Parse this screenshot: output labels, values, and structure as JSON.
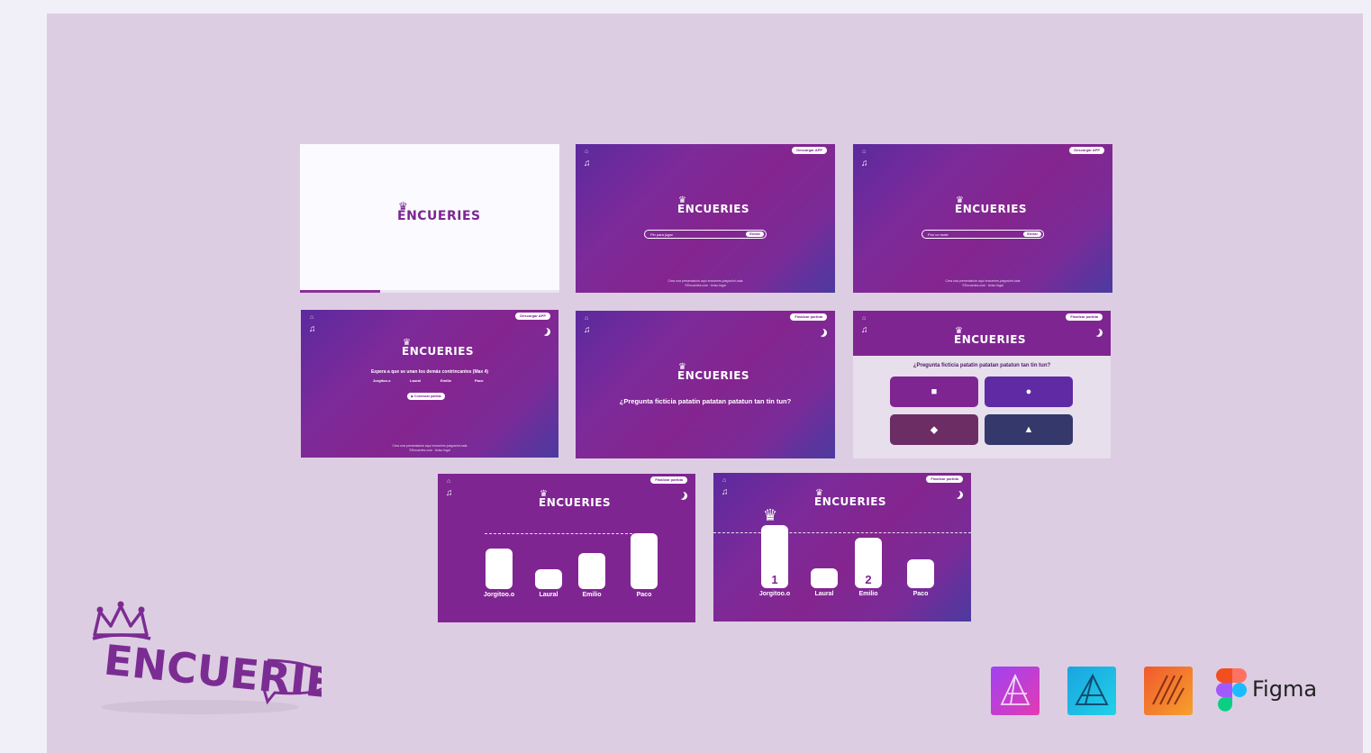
{
  "brand": {
    "logo_text": "ENCUERIES",
    "crown": "♛"
  },
  "screens": {
    "splash": {
      "progress": 0.31
    },
    "join": {
      "download_btn": "Descargar APP",
      "search_placeholder": "Pin para jugar",
      "enter_label": "Entrar",
      "footnote_line1": "Crea una presentación aquí encueries.juegos/mi-sala",
      "footnote_line2": "©Encueries.com · Aviso legal"
    },
    "nickname": {
      "download_btn": "Descargar APP",
      "search_placeholder": "Pon un mote",
      "enter_label": "Entrar",
      "footnote_line1": "Crea una presentación aquí encueries.juegos/mi-sala",
      "footnote_line2": "©Encueries.com · Aviso legal"
    },
    "lobby": {
      "download_btn": "Descargar APP",
      "waiting_text": "Espera a que se unan los demás contrincantes (Max 4)",
      "players": [
        "Jorgitoo.o",
        "Laural",
        "Emilio",
        "Paco"
      ],
      "start_btn": "▶ Comenzar partida",
      "footnote_line1": "Crea una presentación aquí encueries.juegos/mi-sala",
      "footnote_line2": "©Encueries.com · Aviso legal"
    },
    "question": {
      "top_btn": "Finalizar partida",
      "question": "¿Pregunta ficticia patatin patatan patatun tan tin tun?"
    },
    "answers": {
      "top_btn": "Finalizar partida",
      "question": "¿Pregunta ficticia patatin patatan patatun tan tin tun?",
      "options": [
        {
          "shape": "■",
          "color": "#7e2592"
        },
        {
          "shape": "●",
          "color": "#5f2aa3"
        },
        {
          "shape": "◆",
          "color": "#6c2d64"
        },
        {
          "shape": "▲",
          "color": "#34386b"
        }
      ]
    },
    "scores": {
      "top_btn": "Finalizar partida",
      "players": [
        "Jorgitoo.o",
        "Laural",
        "Emilio",
        "Paco"
      ],
      "scores": [
        45,
        22,
        40,
        62
      ]
    },
    "podium": {
      "top_btn": "Finalizar partida",
      "players": [
        "Jorgitoo.o",
        "Laural",
        "Emilio",
        "Paco"
      ],
      "scores": [
        70,
        22,
        56,
        32
      ],
      "ranks": [
        "1",
        "",
        "2",
        ""
      ]
    }
  },
  "tools": {
    "figma_label": "Figma",
    "icons": [
      "affinity-photo-icon",
      "affinity-designer-icon",
      "affinity-publisher-icon",
      "figma-icon"
    ]
  }
}
